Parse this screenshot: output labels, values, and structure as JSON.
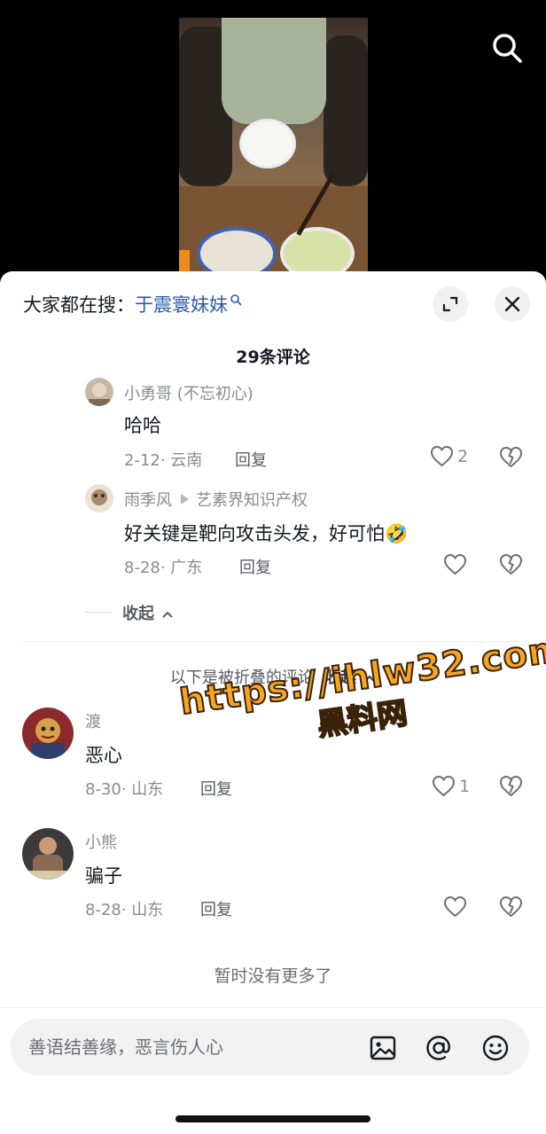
{
  "search_hint": {
    "prefix": "大家都在搜：",
    "keyword": "于震寰妹妹"
  },
  "comments_title": "29条评论",
  "replies": [
    {
      "user": "小勇哥 (不忘初心)",
      "text": "哈哈",
      "meta": "2-12· 云南",
      "reply_label": "回复",
      "likes": "2"
    },
    {
      "user": "雨季风",
      "reply_to": "艺素界知识产权",
      "text": "好关键是靶向攻击头发，好可怕🤣",
      "meta": "8-28· 广东",
      "reply_label": "回复",
      "likes": ""
    }
  ],
  "collapse_label": "收起",
  "folded_notice": {
    "text": "以下是被折叠的评论",
    "action": "收起"
  },
  "comments": [
    {
      "user": "渡",
      "text": "恶心",
      "meta": "8-30· 山东",
      "reply_label": "回复",
      "likes": "1"
    },
    {
      "user": "小熊",
      "text": "骗子",
      "meta": "8-28· 山东",
      "reply_label": "回复",
      "likes": ""
    }
  ],
  "no_more": "暂时没有更多了",
  "input": {
    "placeholder": "善语结善缘，恶言伤人心"
  },
  "watermark": {
    "line1": "https://ihlw32.com",
    "line2": "黑料网"
  },
  "colors": {
    "accent_link": "#2b5aab",
    "watermark": "#f5a623"
  }
}
